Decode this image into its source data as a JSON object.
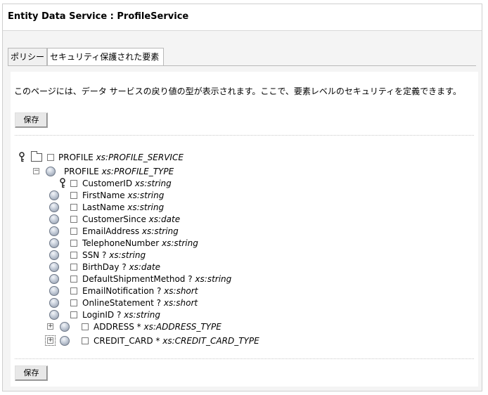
{
  "header": {
    "title": "Entity Data Service : ProfileService"
  },
  "tabs": [
    {
      "label": "ポリシー"
    },
    {
      "label": "セキュリティ保護された要素"
    }
  ],
  "description": "このページには、データ サービスの戻り値の型が表示されます。ここで、要素レベルのセキュリティを定義できます。",
  "save_label": "保存",
  "tree": {
    "root": {
      "name": "PROFILE",
      "type": "xs:PROFILE_SERVICE"
    },
    "profile": {
      "name": "PROFILE",
      "type": "xs:PROFILE_TYPE"
    },
    "fields": [
      {
        "name": "CustomerID",
        "type": "xs:string"
      },
      {
        "name": "FirstName",
        "type": "xs:string"
      },
      {
        "name": "LastName",
        "type": "xs:string"
      },
      {
        "name": "CustomerSince",
        "type": "xs:date"
      },
      {
        "name": "EmailAddress",
        "type": "xs:string"
      },
      {
        "name": "TelephoneNumber",
        "type": "xs:string"
      },
      {
        "name": "SSN ?",
        "type": "xs:string"
      },
      {
        "name": "BirthDay ?",
        "type": "xs:date"
      },
      {
        "name": "DefaultShipmentMethod ?",
        "type": "xs:string"
      },
      {
        "name": "EmailNotification ?",
        "type": "xs:short"
      },
      {
        "name": "OnlineStatement ?",
        "type": "xs:short"
      },
      {
        "name": "LoginID ?",
        "type": "xs:string"
      }
    ],
    "complex": [
      {
        "name": "ADDRESS *",
        "type": "xs:ADDRESS_TYPE"
      },
      {
        "name": "CREDIT_CARD *",
        "type": "xs:CREDIT_CARD_TYPE"
      }
    ]
  }
}
